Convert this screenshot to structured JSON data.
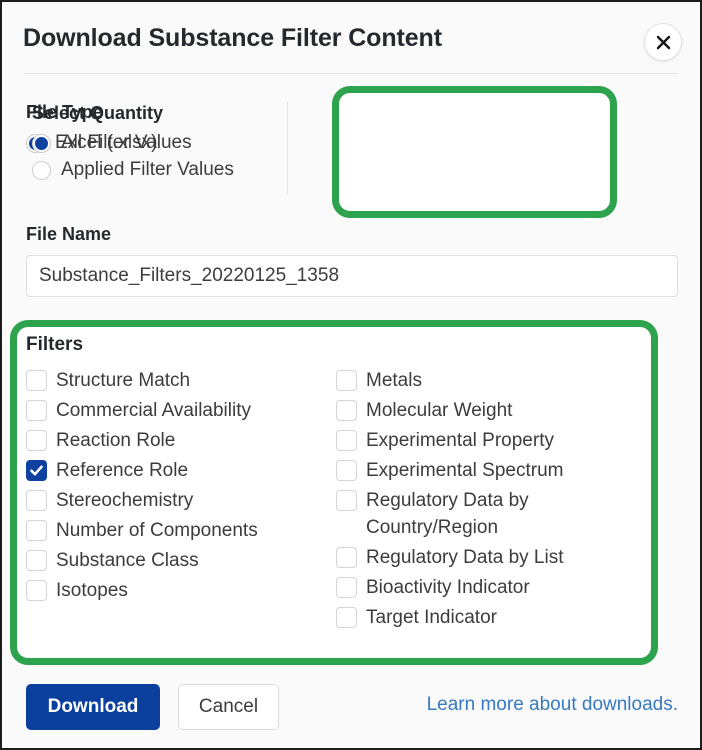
{
  "dialog": {
    "title": "Download Substance Filter Content",
    "close_icon": "close-icon"
  },
  "file_type": {
    "label": "File Type",
    "options": [
      {
        "label": "Excel (.xlsx)",
        "selected": true
      }
    ]
  },
  "select_quantity": {
    "label": "Select Quantity",
    "highlight_color": "#2ea34d",
    "options": [
      {
        "label": "All Filter Values",
        "selected": true
      },
      {
        "label": "Applied Filter Values",
        "selected": false
      }
    ]
  },
  "file_name": {
    "label": "File Name",
    "value": "Substance_Filters_20220125_1358",
    "placeholder": "File name"
  },
  "filters": {
    "title": "Filters",
    "highlight_color": "#2ea34d",
    "left_column": [
      {
        "label": "Structure Match",
        "checked": false
      },
      {
        "label": "Commercial Availability",
        "checked": false
      },
      {
        "label": "Reaction Role",
        "checked": false
      },
      {
        "label": "Reference Role",
        "checked": true
      },
      {
        "label": "Stereochemistry",
        "checked": false
      },
      {
        "label": "Number of Components",
        "checked": false
      },
      {
        "label": "Substance Class",
        "checked": false
      },
      {
        "label": "Isotopes",
        "checked": false
      }
    ],
    "right_column": [
      {
        "label": "Metals",
        "checked": false
      },
      {
        "label": "Molecular Weight",
        "checked": false
      },
      {
        "label": "Experimental Property",
        "checked": false
      },
      {
        "label": "Experimental Spectrum",
        "checked": false
      },
      {
        "label": "Regulatory Data by Country/Region",
        "checked": false
      },
      {
        "label": "Regulatory Data by List",
        "checked": false
      },
      {
        "label": "Bioactivity Indicator",
        "checked": false
      },
      {
        "label": "Target Indicator",
        "checked": false
      }
    ]
  },
  "footer": {
    "download_label": "Download",
    "cancel_label": "Cancel",
    "learn_more_label": "Learn more about downloads.",
    "accent_color": "#0b3f9e",
    "link_color": "#3779c2"
  }
}
